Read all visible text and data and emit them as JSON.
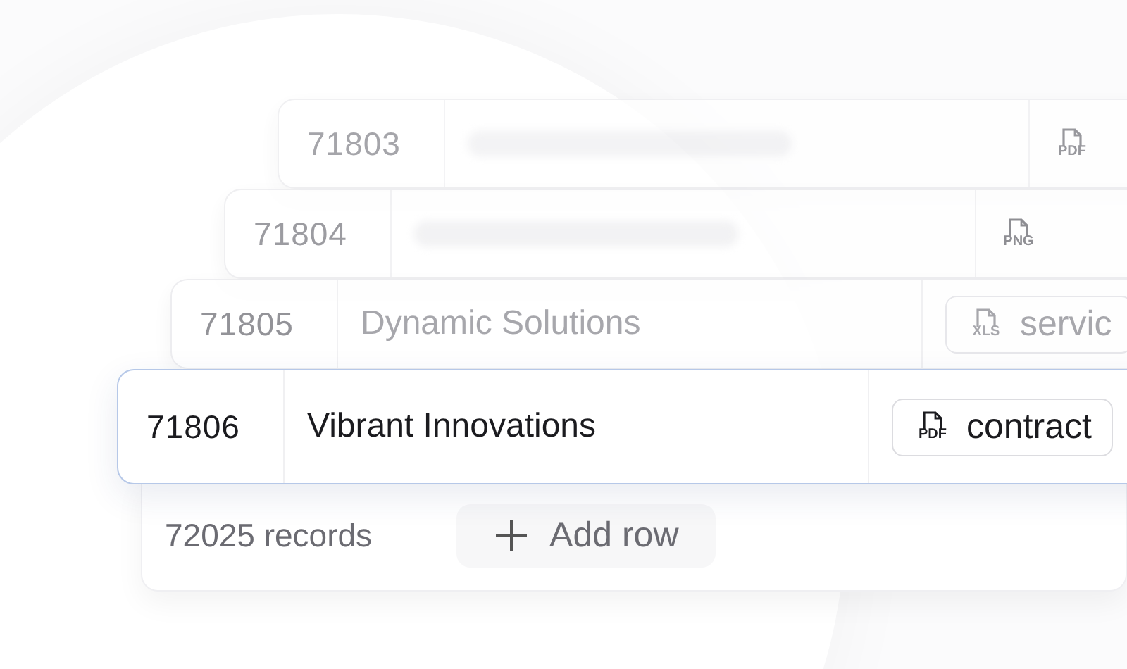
{
  "rows": [
    {
      "id": "71803",
      "file": {
        "type": "PDF"
      },
      "selected": false
    },
    {
      "id": "71804",
      "file": {
        "type": "PNG"
      },
      "selected": false
    },
    {
      "id": "71805",
      "name": "Dynamic Solutions",
      "file": {
        "type": "XLS",
        "name": "servic"
      },
      "selected": false
    },
    {
      "id": "71806",
      "name": "Vibrant Innovations",
      "file": {
        "type": "PDF",
        "name": "contract"
      },
      "selected": true
    }
  ],
  "footer": {
    "count": "72025 records",
    "add_button": "Add row"
  }
}
